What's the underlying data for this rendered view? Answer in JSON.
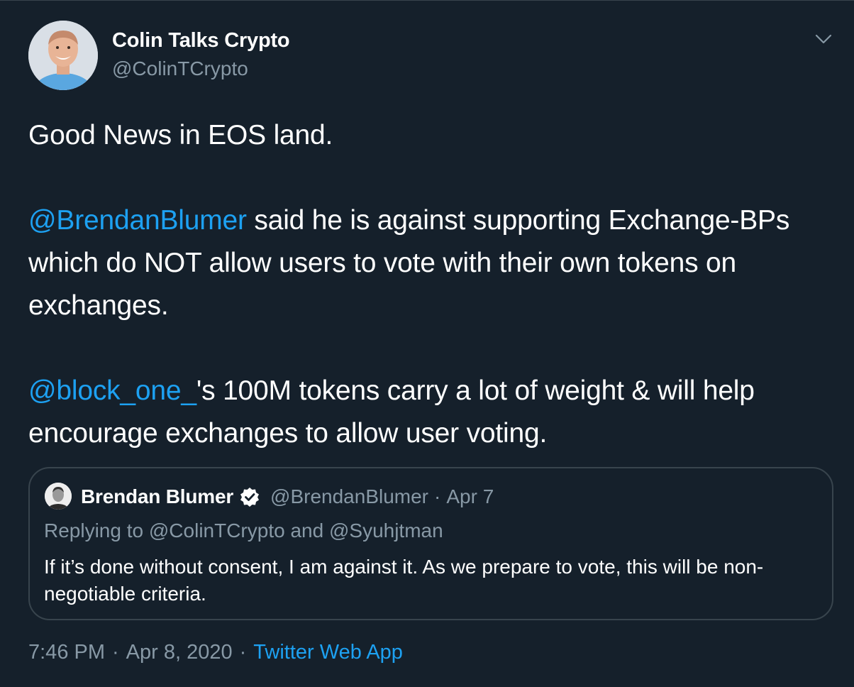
{
  "author": {
    "name": "Colin Talks Crypto",
    "handle": "@ColinTCrypto"
  },
  "tweet": {
    "line1": "Good News in EOS land.",
    "para2_mention": "@BrendanBlumer",
    "para2_rest": " said he is against supporting Exchange-BPs which do NOT allow users to vote with their own tokens on exchanges.",
    "para3_mention": "@block_one_",
    "para3_rest": "'s 100M tokens carry a lot of weight & will help encourage exchanges to allow user voting."
  },
  "quoted_tweet": {
    "name": "Brendan Blumer",
    "handle": "@BrendanBlumer",
    "separator": "·",
    "date": "Apr 7",
    "reply_prefix": "Replying to ",
    "reply_mention_1": "@ColinTCrypto",
    "reply_and": " and ",
    "reply_mention_2": "@Syuhjtman",
    "text": "If it’s done without consent, I am against it. As we prepare to vote, this will be non-negotiable criteria."
  },
  "meta": {
    "time": "7:46 PM",
    "separator": "·",
    "date": "Apr 8, 2020",
    "source": "Twitter Web App"
  },
  "icons": {
    "caret": "chevron-down-icon",
    "verified": "verified-badge-icon"
  },
  "colors": {
    "background": "#15202b",
    "accent": "#1da1f2",
    "secondary_text": "#8899a6",
    "border": "#38444d"
  }
}
